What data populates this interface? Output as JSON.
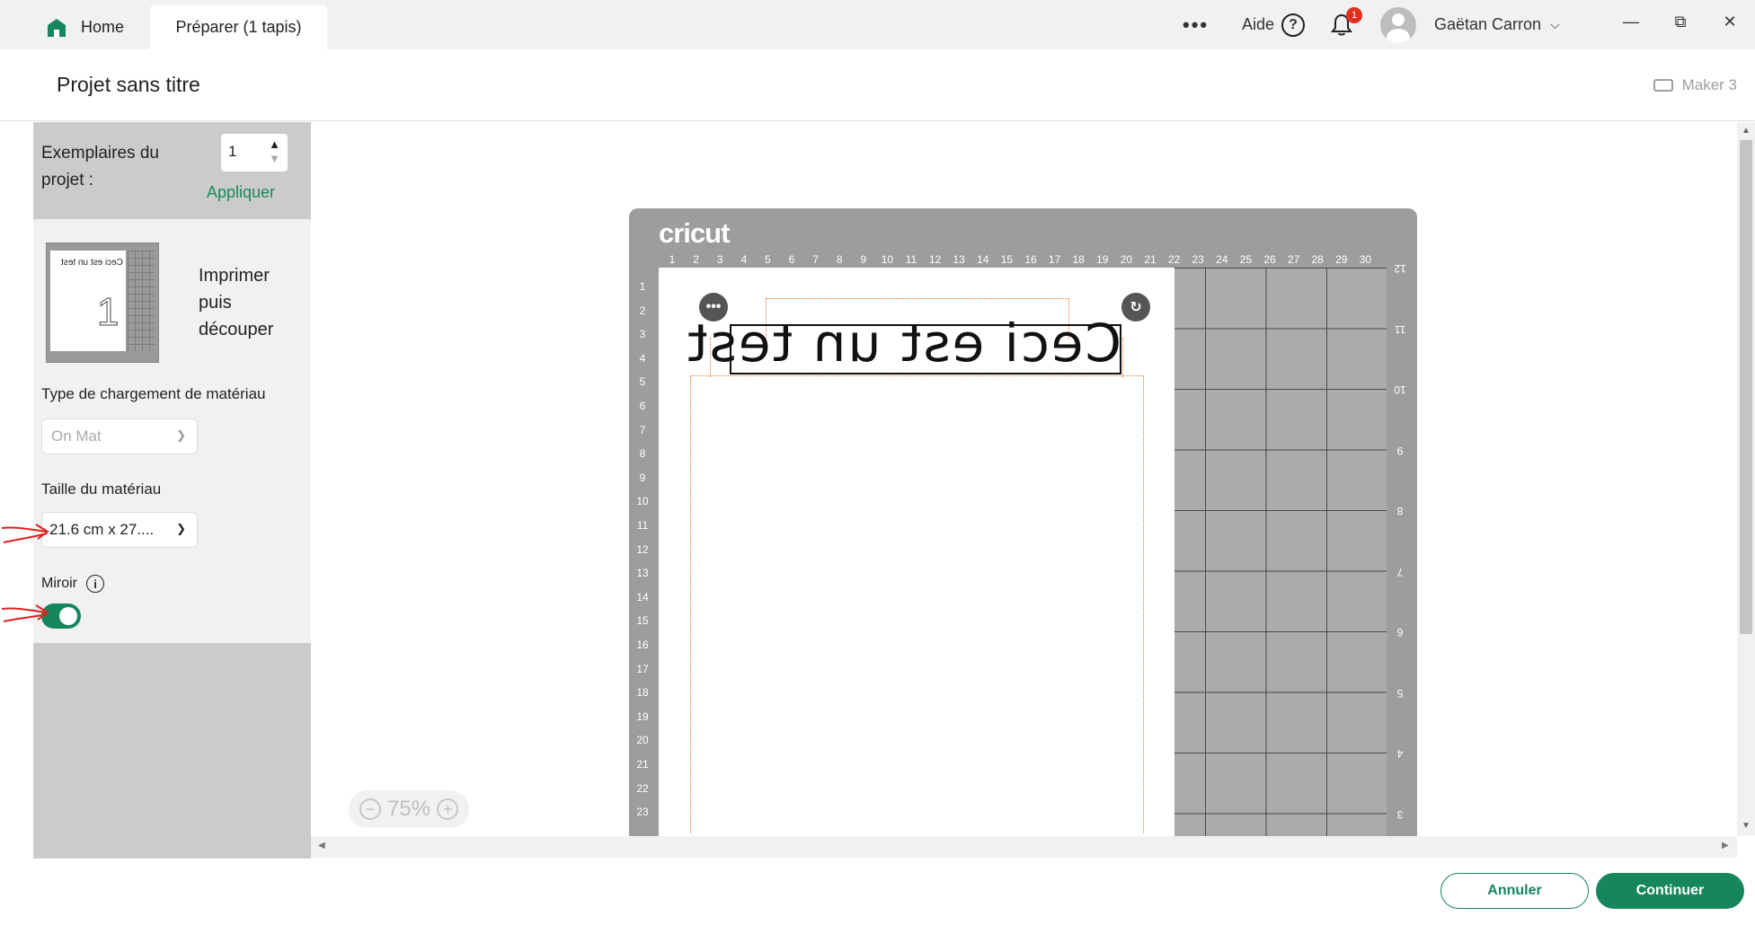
{
  "tabs": {
    "home_label": "Home",
    "prepare_label": "Préparer (1 tapis)"
  },
  "header": {
    "more_label": "•••",
    "help_label": "Aide",
    "help_glyph": "?",
    "notifications_count": "1",
    "user_name": "Gaëtan Carron",
    "window_minimize": "—",
    "window_restore": "⧉",
    "window_close": "✕"
  },
  "project": {
    "title": "Projet sans titre",
    "machine": "Maker 3"
  },
  "left_panel": {
    "copies_label": "Exemplaires du projet :",
    "copies_value": "1",
    "apply_label": "Appliquer",
    "thumb_text": "Ceci est un test",
    "thumb_number": "1",
    "mode_label": "Imprimer puis découper",
    "load_type_label": "Type de chargement de matériau",
    "load_type_value": "On Mat",
    "material_size_label": "Taille du matériau",
    "material_size_value": "21.6 cm x 27....",
    "mirror_label": "Miroir",
    "mirror_on": true
  },
  "mat": {
    "brand": "cricut",
    "top_ruler": [
      "1",
      "2",
      "3",
      "4",
      "5",
      "6",
      "7",
      "8",
      "9",
      "10",
      "11",
      "12",
      "13",
      "14",
      "15",
      "16",
      "17",
      "18",
      "19",
      "20",
      "21",
      "22",
      "23",
      "24",
      "25",
      "26",
      "27",
      "28",
      "29",
      "30"
    ],
    "left_ruler": [
      "1",
      "2",
      "3",
      "4",
      "5",
      "6",
      "7",
      "8",
      "9",
      "10",
      "11",
      "12",
      "13",
      "14",
      "15",
      "16",
      "17",
      "18",
      "19",
      "20",
      "21",
      "22",
      "23"
    ],
    "right_ruler": [
      "12",
      "11",
      "10",
      "9",
      "8",
      "7",
      "6",
      "5",
      "4",
      "3"
    ],
    "design_text": "Ceci est un test"
  },
  "zoom": {
    "minus": "−",
    "value": "75%",
    "plus": "+"
  },
  "footer": {
    "cancel_label": "Annuler",
    "continue_label": "Continuer"
  },
  "colors": {
    "accent": "#16875c",
    "mat_gray": "#9d9d9d",
    "badge_red": "#e0301e",
    "cutline_orange": "#e8752f"
  }
}
